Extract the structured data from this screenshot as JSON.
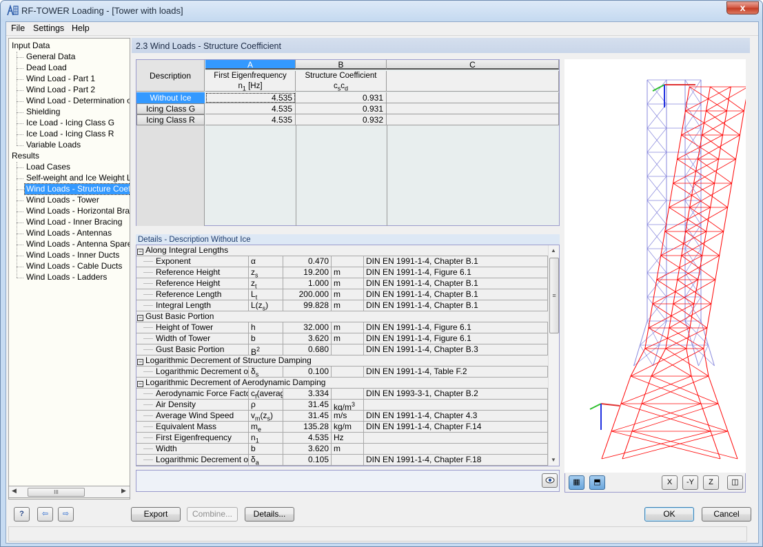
{
  "window": {
    "title": "RF-TOWER Loading - [Tower with loads]",
    "close_label": "x"
  },
  "menu": [
    "File",
    "Settings",
    "Help"
  ],
  "tree": {
    "input_root": "Input Data",
    "input_items": [
      "General Data",
      "Dead Load",
      "Wind Load - Part 1",
      "Wind Load - Part 2",
      "Wind Load - Determination of G",
      "Shielding",
      "Ice Load - Icing Class G",
      "Ice Load - Icing Class R",
      "Variable Loads"
    ],
    "results_root": "Results",
    "results_items": [
      "Load Cases",
      "Self-weight and Ice Weight Loa",
      "Wind Loads - Structure Coefficie",
      "Wind Loads - Tower",
      "Wind Loads - Horizontal Bracing",
      "Wind Load - Inner Bracing",
      "Wind Loads - Antennas",
      "Wind Loads - Antenna Spare Ar",
      "Wind Loads - Inner Ducts",
      "Wind Loads - Cable Ducts",
      "Wind Loads - Ladders"
    ],
    "selected": "Wind Loads - Structure Coefficie",
    "scroll_thumb": "III"
  },
  "section_title": "2.3 Wind Loads - Structure Coefficient",
  "main_table": {
    "desc_header": "Description",
    "columns": [
      {
        "letter": "A",
        "title": "First Eigenfrequency",
        "unit_main": "n",
        "unit_sub": "1",
        "unit_rest": " [Hz]"
      },
      {
        "letter": "B",
        "title": "Structure Coefficient",
        "unit_main": "c",
        "unit_sub": "s",
        "unit_rest": "c",
        "unit_sub2": "d"
      },
      {
        "letter": "C",
        "title": ""
      }
    ],
    "rows": [
      {
        "label": "Without Ice",
        "freq": "4.535",
        "coef": "0.931"
      },
      {
        "label": "Icing Class G",
        "freq": "4.535",
        "coef": "0.931"
      },
      {
        "label": "Icing Class R",
        "freq": "4.535",
        "coef": "0.932"
      }
    ]
  },
  "details": {
    "header": "Details  -  Description Without Ice",
    "groups": [
      {
        "title": "Along Integral Lengths",
        "rows": [
          {
            "name": "Exponent",
            "sym": "α",
            "sub": "",
            "val": "0.470",
            "unit": "",
            "ref": "DIN EN 1991-1-4, Chapter B.1"
          },
          {
            "name": "Reference Height",
            "sym": "z",
            "sub": "s",
            "val": "19.200",
            "unit": "m",
            "ref": "DIN EN 1991-1-4, Figure 6.1"
          },
          {
            "name": "Reference Height",
            "sym": "z",
            "sub": "t",
            "val": "1.000",
            "unit": "m",
            "ref": "DIN EN 1991-1-4, Chapter B.1"
          },
          {
            "name": "Reference Length",
            "sym": "L",
            "sub": "t",
            "val": "200.000",
            "unit": "m",
            "ref": "DIN EN 1991-1-4, Chapter B.1"
          },
          {
            "name": "Integral Length",
            "sym": "L(z",
            "sub": "s",
            "post": ")",
            "val": "99.828",
            "unit": "m",
            "ref": "DIN EN 1991-1-4, Chapter B.1"
          }
        ]
      },
      {
        "title": "Gust Basic Portion",
        "rows": [
          {
            "name": "Height of Tower",
            "sym": "h",
            "sub": "",
            "val": "32.000",
            "unit": "m",
            "ref": "DIN EN 1991-1-4, Figure 6.1"
          },
          {
            "name": "Width of Tower",
            "sym": "b",
            "sub": "",
            "val": "3.620",
            "unit": "m",
            "ref": "DIN EN 1991-1-4, Figure 6.1"
          },
          {
            "name": "Gust Basic Portion",
            "sym": "B",
            "sup": "2",
            "val": "0.680",
            "unit": "",
            "ref": "DIN EN 1991-1-4, Chapter B.3"
          }
        ]
      },
      {
        "title": "Logarithmic Decrement of Structure Damping",
        "rows": [
          {
            "name": "Logarithmic Decrement of S",
            "sym": "δ",
            "sub": "s",
            "val": "0.100",
            "unit": "",
            "ref": "DIN EN 1991-1-4, Table F.2"
          }
        ]
      },
      {
        "title": "Logarithmic Decrement of Aerodynamic Damping",
        "rows": [
          {
            "name": "Aerodynamic Force Factor",
            "sym": "c",
            "sub": "f",
            "post": "(averag",
            "val": "3.334",
            "unit": "",
            "ref": "DIN EN 1993-3-1, Chapter B.2"
          },
          {
            "name": "Air Density",
            "sym": "ρ",
            "sub": "",
            "val": "31.45",
            "unit": "kg/m",
            "unit_sup": "3",
            "ref": ""
          },
          {
            "name": "Average Wind Speed",
            "sym": "v",
            "sub": "m",
            "post": "(z",
            "sub2": "s",
            "post2": ")",
            "val": "31.45",
            "unit": "m/s",
            "ref": "DIN EN 1991-1-4, Chapter 4.3"
          },
          {
            "name": "Equivalent Mass",
            "sym": "m",
            "sub": "e",
            "val": "135.28",
            "unit": "kg/m",
            "ref": "DIN EN 1991-1-4, Chapter F.14"
          },
          {
            "name": "First Eigenfrequency",
            "sym": "n",
            "sub": "1",
            "val": "4.535",
            "unit": "Hz",
            "ref": ""
          },
          {
            "name": "Width",
            "sym": "b",
            "sub": "",
            "val": "3.620",
            "unit": "m",
            "ref": ""
          },
          {
            "name": "Logarithmic Decrement of A",
            "sym": "δ",
            "sub": "a",
            "val": "0.105",
            "unit": "",
            "ref": "DIN EN 1991-1-4, Chapter F.18"
          }
        ]
      }
    ]
  },
  "view_tools": {
    "x_label": "X",
    "y_label": "-Y",
    "z_label": "Z"
  },
  "buttons": {
    "export": "Export",
    "combine": "Combine...",
    "details": "Details...",
    "ok": "OK",
    "cancel": "Cancel"
  },
  "colors": {
    "selection": "#3399ff",
    "deformed": "#ff0000",
    "undeformed": "#8888dd"
  }
}
